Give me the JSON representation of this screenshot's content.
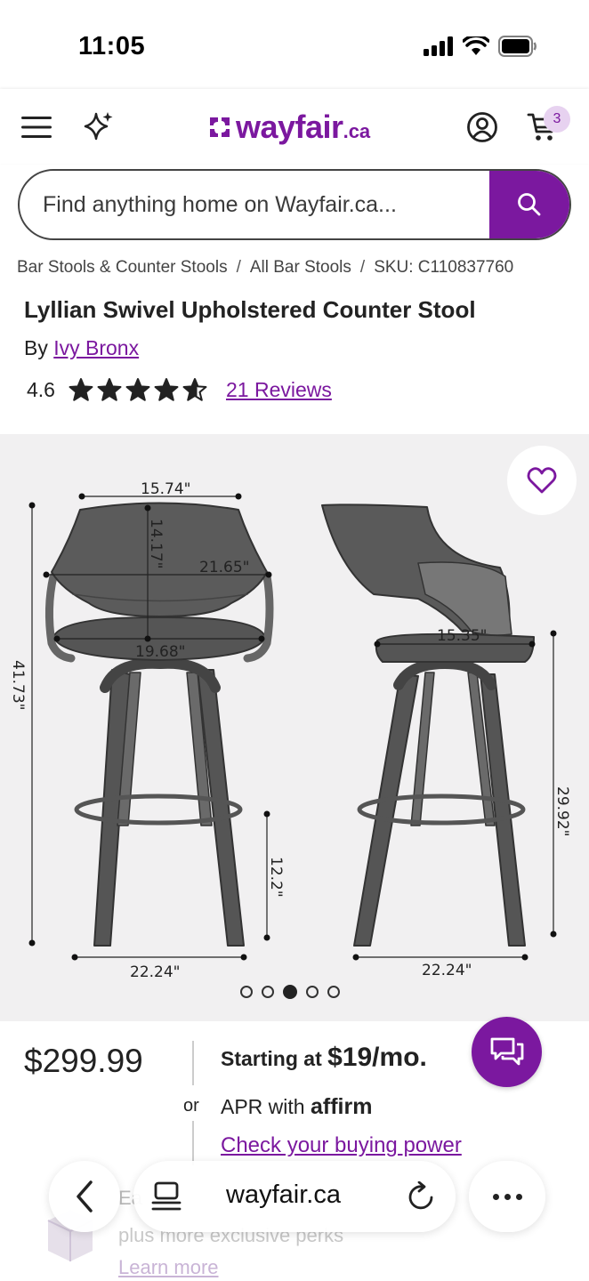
{
  "status": {
    "time": "11:05"
  },
  "header": {
    "logo_word": "wayfair",
    "logo_suffix": ".ca",
    "cart_count": "3",
    "brand_color": "#7b189f"
  },
  "search": {
    "placeholder": "Find anything home on Wayfair.ca..."
  },
  "breadcrumb": {
    "items": [
      "Bar Stools & Counter Stools",
      "All Bar Stools",
      "SKU: C110837760"
    ],
    "separator": "/"
  },
  "product": {
    "title": "Lyllian Swivel Upholstered Counter Stool",
    "by_label": "By",
    "brand": "Ivy Bronx",
    "rating": "4.6",
    "rating_value": 4.6,
    "reviews_label": "21 Reviews"
  },
  "gallery": {
    "dimensions": {
      "front_seat_width": "15.74\"",
      "front_back_height": "14.17\"",
      "front_arm_width": "21.65\"",
      "front_seat_depth": "19.68\"",
      "total_height": "41.73\"",
      "footrest_height": "12.2\"",
      "front_base_width": "22.24\"",
      "side_seat_depth": "15.35\"",
      "seat_height": "29.92\"",
      "side_base_width": "22.24\""
    },
    "slide_count": 5,
    "active_slide": 3
  },
  "pricing": {
    "price": "$299.99",
    "or_label": "or",
    "starting_prefix": "Starting at ",
    "monthly": "$19/mo.",
    "apr_prefix": "APR with ",
    "affirm": "affirm",
    "buying_power_link": "Check your buying power"
  },
  "promo": {
    "line_top": "Ea",
    "line_top_tail": "b",
    "line": "plus more exclusive perks",
    "link": "Learn more"
  },
  "browser": {
    "url": "wayfair.ca"
  },
  "icons": {
    "menu": "menu-icon",
    "sparkle": "sparkle-icon",
    "account": "account-icon",
    "cart": "cart-icon",
    "search": "search-icon",
    "heart": "heart-icon",
    "chat": "chat-icon",
    "back": "chevron-left-icon",
    "reader": "reader-icon",
    "reload": "reload-icon",
    "more": "more-icon"
  }
}
